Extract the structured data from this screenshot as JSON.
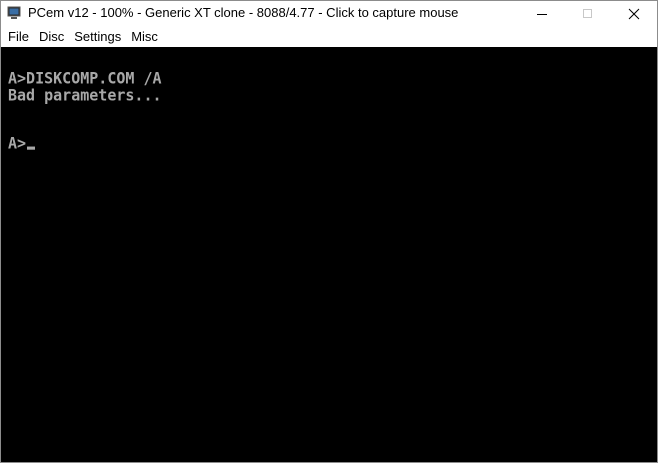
{
  "window": {
    "title": "PCem v12 - 100% - Generic XT clone - 8088/4.77 - Click to capture mouse",
    "icon": "pcem-app-icon",
    "controls": {
      "minimize_icon": "minimize-icon",
      "maximize_icon": "maximize-icon",
      "close_icon": "close-icon"
    }
  },
  "menu": {
    "items": [
      {
        "label": "File"
      },
      {
        "label": "Disc"
      },
      {
        "label": "Settings"
      },
      {
        "label": "Misc"
      }
    ]
  },
  "console": {
    "lines": [
      "A>DISKCOMP.COM /A",
      "Bad parameters...",
      "A>"
    ],
    "text_color": "#a8a8a8",
    "background": "#000000"
  }
}
